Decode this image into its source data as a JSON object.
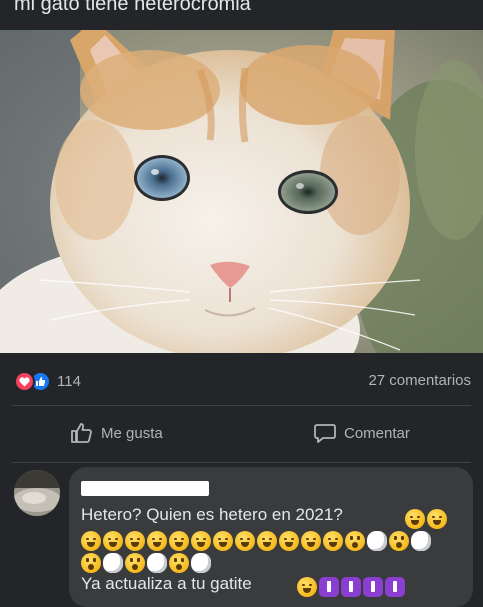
{
  "post": {
    "caption": "mi gato tiene heterocromia",
    "photo_icon": "cat-photo"
  },
  "stats": {
    "reaction_icons": [
      "love-reaction-icon",
      "like-reaction-icon"
    ],
    "reaction_count": "114",
    "comment_count": "27 comentarios"
  },
  "actions": {
    "like_label": "Me gusta",
    "comment_label": "Comentar"
  },
  "comment": {
    "line1": "Hetero? Quien es hetero en 2021?",
    "line4": "Ya actualiza a tu gatite",
    "emoji_row_1": [
      "laugh",
      "laugh"
    ],
    "emoji_row_2": [
      "laugh",
      "laugh",
      "laugh",
      "laugh",
      "laugh",
      "laugh",
      "laugh",
      "laugh",
      "laugh",
      "laugh",
      "laugh",
      "laugh",
      "wow",
      "puff",
      "wow",
      "puff"
    ],
    "emoji_row_3": [
      "wow",
      "puff",
      "wow",
      "puff",
      "wow",
      "puff"
    ],
    "emoji_row_4": [
      "laugh",
      "purple",
      "purple",
      "purple",
      "purple"
    ]
  },
  "colors": {
    "background": "#232529",
    "bubble": "#3a3b3c",
    "text": "#e4e6eb",
    "muted_text": "#b0b3b8",
    "love": "#f3425f",
    "like": "#1877f2"
  }
}
